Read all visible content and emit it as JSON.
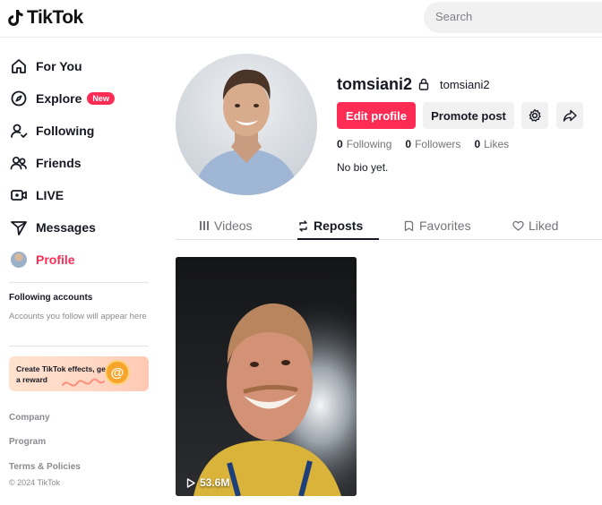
{
  "header": {
    "logo_text": "TikTok",
    "search_placeholder": "Search"
  },
  "sidebar": {
    "nav": [
      {
        "label": "For You",
        "icon": "home-icon"
      },
      {
        "label": "Explore",
        "icon": "compass-icon",
        "badge": "New"
      },
      {
        "label": "Following",
        "icon": "following-icon"
      },
      {
        "label": "Friends",
        "icon": "friends-icon"
      },
      {
        "label": "LIVE",
        "icon": "live-icon"
      },
      {
        "label": "Messages",
        "icon": "messages-icon"
      },
      {
        "label": "Profile",
        "icon": "avatar",
        "active": true
      }
    ],
    "following_heading": "Following accounts",
    "following_note": "Accounts you follow will appear here",
    "effects_card_text": "Create TikTok effects, get a reward",
    "footer_links": [
      "Company",
      "Program",
      "Terms & Policies"
    ],
    "copyright": "© 2024 TikTok"
  },
  "profile": {
    "username": "tomsiani2",
    "handle": "tomsiani2",
    "edit_button": "Edit profile",
    "promote_button": "Promote post",
    "stats": [
      {
        "count": "0",
        "label": "Following"
      },
      {
        "count": "0",
        "label": "Followers"
      },
      {
        "count": "0",
        "label": "Likes"
      }
    ],
    "bio": "No bio yet."
  },
  "tabs": [
    {
      "label": "Videos",
      "icon": "grid-icon"
    },
    {
      "label": "Reposts",
      "icon": "repost-icon",
      "active": true
    },
    {
      "label": "Favorites",
      "icon": "bookmark-icon"
    },
    {
      "label": "Liked",
      "icon": "heart-icon"
    }
  ],
  "videos": [
    {
      "views": "53.6M"
    }
  ],
  "colors": {
    "accent": "#fe2c55",
    "text": "#161823",
    "muted": "#73747b"
  }
}
